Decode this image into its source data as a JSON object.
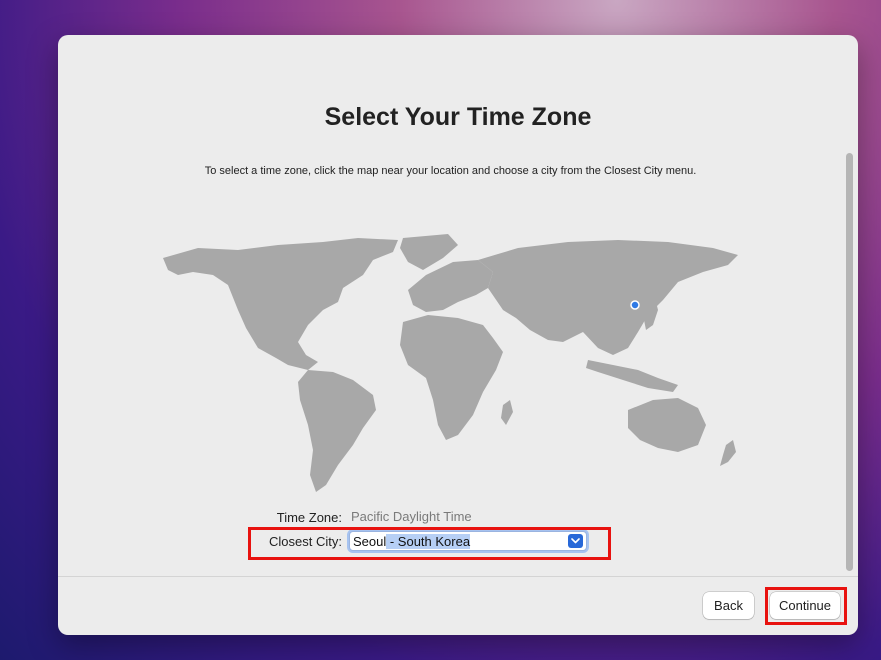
{
  "page": {
    "title": "Select Your Time Zone",
    "instructions": "To select a time zone, click the map near your location and choose a city from the Closest City menu."
  },
  "map": {
    "selected_city": "Seoul"
  },
  "form": {
    "time_zone_label": "Time Zone:",
    "time_zone_value": "Pacific Daylight Time",
    "closest_city_label": "Closest City:",
    "closest_city_typed": "Seoul",
    "closest_city_completion": " - South Korea",
    "dropdown_icon": "chevron-down-icon"
  },
  "buttons": {
    "back_label": "Back",
    "continue_label": "Continue"
  },
  "colors": {
    "highlight": "#e8120f",
    "accent": "#2868d8",
    "map_land": "#a8a8a8"
  }
}
